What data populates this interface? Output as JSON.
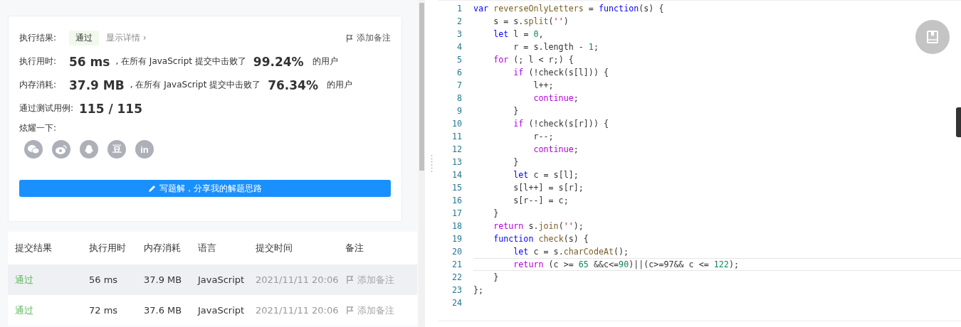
{
  "result_card": {
    "status_label": "执行结果:",
    "status": "通过",
    "details_link": "显示详情 ›",
    "note_button": "添加备注",
    "stats": [
      {
        "label": "执行用时:",
        "value": "56 ms",
        "text": ", 在所有 JavaScript 提交中击败了",
        "percent": "99.24%",
        "suffix": "的用户"
      },
      {
        "label": "内存消耗:",
        "value": "37.9 MB",
        "text": ", 在所有 JavaScript 提交中击败了",
        "percent": "76.34%",
        "suffix": "的用户"
      }
    ],
    "cases_label": "通过测试用例:",
    "cases_value": "115 / 115",
    "share_label": "炫耀一下:",
    "share": [
      {
        "kind": "chat"
      },
      {
        "kind": "eye"
      },
      {
        "kind": "penguin"
      },
      {
        "kind": "text",
        "label": "豆"
      },
      {
        "kind": "text",
        "label": "in"
      }
    ],
    "write_button": "写题解，分享我的解题思路"
  },
  "submissions": {
    "columns": [
      "提交结果",
      "执行用时",
      "内存消耗",
      "语言",
      "提交时间",
      "备注"
    ],
    "rows": [
      {
        "result": "通过",
        "time": "56 ms",
        "memory": "37.9 MB",
        "language": "JavaScript",
        "submitted": "2021/11/11 20:06",
        "note": "添加备注",
        "hovered": true
      },
      {
        "result": "通过",
        "time": "72 ms",
        "memory": "37.6 MB",
        "language": "JavaScript",
        "submitted": "2021/11/11 20:06",
        "note": "添加备注",
        "hovered": false
      }
    ]
  },
  "editor": {
    "lines": [
      {
        "number": "1",
        "active": false,
        "tokens": [
          {
            "kind": "keyword",
            "text": "var "
          },
          {
            "kind": "function",
            "text": "reverseOnlyLetters"
          },
          {
            "kind": "plain",
            "text": " = "
          },
          {
            "kind": "keyword",
            "text": "function"
          },
          {
            "kind": "plain",
            "text": "(s) {"
          }
        ]
      },
      {
        "number": "2",
        "active": false,
        "tokens": [
          {
            "kind": "plain",
            "text": "    s = s."
          },
          {
            "kind": "function",
            "text": "split"
          },
          {
            "kind": "plain",
            "text": "("
          },
          {
            "kind": "string",
            "text": "''"
          },
          {
            "kind": "plain",
            "text": ")"
          }
        ]
      },
      {
        "number": "3",
        "active": false,
        "tokens": [
          {
            "kind": "keyword",
            "text": "    let"
          },
          {
            "kind": "plain",
            "text": " l = "
          },
          {
            "kind": "number",
            "text": "0"
          },
          {
            "kind": "plain",
            "text": ","
          }
        ]
      },
      {
        "number": "4",
        "active": false,
        "tokens": [
          {
            "kind": "plain",
            "text": "        r = s.length - "
          },
          {
            "kind": "number",
            "text": "1"
          },
          {
            "kind": "plain",
            "text": ";"
          }
        ]
      },
      {
        "number": "5",
        "active": false,
        "tokens": [
          {
            "kind": "control",
            "text": "    for"
          },
          {
            "kind": "plain",
            "text": " (; l < r;) {"
          }
        ]
      },
      {
        "number": "6",
        "active": false,
        "tokens": [
          {
            "kind": "control",
            "text": "        if"
          },
          {
            "kind": "plain",
            "text": " (!check(s[l])) {"
          }
        ]
      },
      {
        "number": "7",
        "active": false,
        "tokens": [
          {
            "kind": "plain",
            "text": "            l++;"
          }
        ]
      },
      {
        "number": "8",
        "active": false,
        "tokens": [
          {
            "kind": "control",
            "text": "            continue"
          },
          {
            "kind": "plain",
            "text": ";"
          }
        ]
      },
      {
        "number": "9",
        "active": false,
        "tokens": [
          {
            "kind": "plain",
            "text": "        }"
          }
        ]
      },
      {
        "number": "10",
        "active": false,
        "tokens": [
          {
            "kind": "control",
            "text": "        if"
          },
          {
            "kind": "plain",
            "text": " (!check(s[r])) {"
          }
        ]
      },
      {
        "number": "11",
        "active": false,
        "tokens": [
          {
            "kind": "plain",
            "text": "            r--;"
          }
        ]
      },
      {
        "number": "12",
        "active": false,
        "tokens": [
          {
            "kind": "control",
            "text": "            continue"
          },
          {
            "kind": "plain",
            "text": ";"
          }
        ]
      },
      {
        "number": "13",
        "active": false,
        "tokens": [
          {
            "kind": "plain",
            "text": "        }"
          }
        ]
      },
      {
        "number": "14",
        "active": false,
        "tokens": [
          {
            "kind": "keyword",
            "text": "        let"
          },
          {
            "kind": "plain",
            "text": " c = s[l];"
          }
        ]
      },
      {
        "number": "15",
        "active": false,
        "tokens": [
          {
            "kind": "plain",
            "text": "        s[l++] = s[r];"
          }
        ]
      },
      {
        "number": "16",
        "active": false,
        "tokens": [
          {
            "kind": "plain",
            "text": "        s[r--] = c;"
          }
        ]
      },
      {
        "number": "17",
        "active": false,
        "tokens": [
          {
            "kind": "plain",
            "text": "    }"
          }
        ]
      },
      {
        "number": "18",
        "active": false,
        "tokens": [
          {
            "kind": "control",
            "text": "    return"
          },
          {
            "kind": "plain",
            "text": " s."
          },
          {
            "kind": "function",
            "text": "join"
          },
          {
            "kind": "plain",
            "text": "("
          },
          {
            "kind": "string",
            "text": "''"
          },
          {
            "kind": "plain",
            "text": ");"
          }
        ]
      },
      {
        "number": "19",
        "active": false,
        "tokens": [
          {
            "kind": "keyword",
            "text": "    function "
          },
          {
            "kind": "function",
            "text": "check"
          },
          {
            "kind": "plain",
            "text": "(s) {"
          }
        ]
      },
      {
        "number": "20",
        "active": false,
        "tokens": [
          {
            "kind": "keyword",
            "text": "        let"
          },
          {
            "kind": "plain",
            "text": " c = s."
          },
          {
            "kind": "function",
            "text": "charCodeAt"
          },
          {
            "kind": "plain",
            "text": "();"
          }
        ]
      },
      {
        "number": "21",
        "active": true,
        "tokens": [
          {
            "kind": "control",
            "text": "        return"
          },
          {
            "kind": "plain",
            "text": " (c >= "
          },
          {
            "kind": "number",
            "text": "65"
          },
          {
            "kind": "plain",
            "text": " &&c<="
          },
          {
            "kind": "number",
            "text": "90"
          },
          {
            "kind": "plain",
            "text": ")||(c>=97&& c <= "
          },
          {
            "kind": "number",
            "text": "122"
          },
          {
            "kind": "plain",
            "text": ");"
          }
        ]
      },
      {
        "number": "22",
        "active": false,
        "tokens": [
          {
            "kind": "plain",
            "text": "    }"
          }
        ]
      },
      {
        "number": "23",
        "active": false,
        "tokens": [
          {
            "kind": "plain",
            "text": "};"
          }
        ]
      },
      {
        "number": "24",
        "active": false
      }
    ]
  }
}
